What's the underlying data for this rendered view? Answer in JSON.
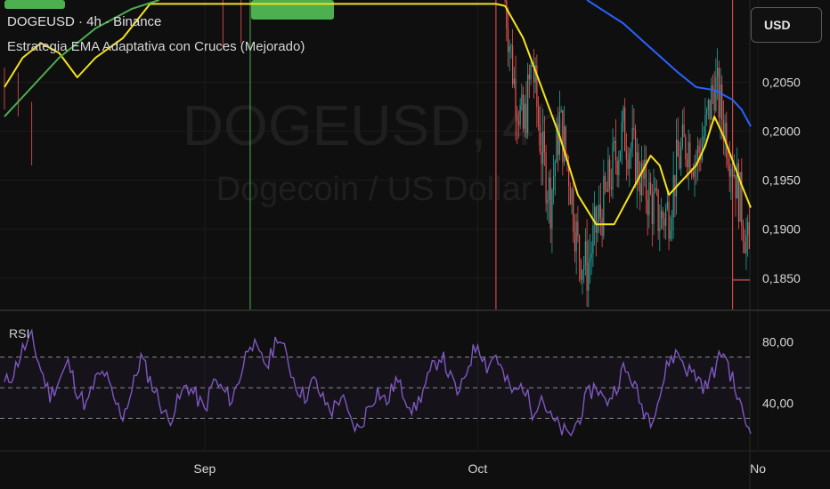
{
  "header": {
    "title": "DOGEUSD · 4h · Binance",
    "indicator": "Estrategia EMA Adaptativa con Cruces (Mejorado)"
  },
  "price_scale": {
    "currency_button": "USD"
  },
  "watermark": {
    "symbol": "DOGEUSD, 4h",
    "description": "Dogecoin / US Dollar"
  },
  "rsi_pane": {
    "label": "RSI"
  },
  "colors": {
    "up": "#26a69a",
    "down": "#ef5350",
    "ema_fast": "#f5e21b",
    "ema_mid": "#4caf50",
    "ema_slow": "#2962ff",
    "rsi": "#7e57c2",
    "signal_green": "#4caf50",
    "signal_red": "#ef5350"
  },
  "chart_data": [
    {
      "type": "candlestick",
      "title": "DOGEUSD · 4h · Binance",
      "x_tick_labels": [
        "Sep",
        "Oct",
        "No"
      ],
      "y_tick_labels": [
        "0,2050",
        "0,2000",
        "0,1950",
        "0,1900",
        "0,1850"
      ],
      "ylim": [
        0.1818,
        0.2134
      ],
      "x_range": [
        "Aug 10",
        "Oct 31"
      ],
      "series": [
        {
          "name": "EMA fast",
          "points": [
            [
              "Aug 10",
              0.2045
            ],
            [
              "Aug 12",
              0.2075
            ],
            [
              "Aug 14",
              0.209
            ],
            [
              "Aug 16",
              0.208
            ],
            [
              "Aug 18",
              0.2055
            ],
            [
              "Aug 20",
              0.2075
            ],
            [
              "Aug 23",
              0.2095
            ],
            [
              "Aug 26",
              0.213
            ],
            [
              "Oct 3",
              0.213
            ],
            [
              "Oct 4",
              0.2128
            ],
            [
              "Oct 6",
              0.2095
            ],
            [
              "Oct 8",
              0.2045
            ],
            [
              "Oct 10",
              0.1995
            ],
            [
              "Oct 12",
              0.1935
            ],
            [
              "Oct 14",
              0.1905
            ],
            [
              "Oct 16",
              0.1905
            ],
            [
              "Oct 18",
              0.194
            ],
            [
              "Oct 20",
              0.1975
            ],
            [
              "Oct 21",
              0.1965
            ],
            [
              "Oct 22",
              0.1935
            ],
            [
              "Oct 23",
              0.1945
            ],
            [
              "Oct 25",
              0.1965
            ],
            [
              "Oct 26",
              0.1985
            ],
            [
              "Oct 27",
              0.2015
            ],
            [
              "Oct 28",
              0.1995
            ],
            [
              "Oct 29",
              0.197
            ],
            [
              "Oct 30",
              0.1945
            ],
            [
              "Oct 31",
              0.1922
            ]
          ]
        },
        {
          "name": "EMA mid",
          "points": [
            [
              "Aug 10",
              0.2015
            ],
            [
              "Aug 13",
              0.2045
            ],
            [
              "Aug 16",
              0.2075
            ],
            [
              "Aug 20",
              0.2105
            ],
            [
              "Aug 24",
              0.2125
            ],
            [
              "Aug 27",
              0.2134
            ]
          ]
        },
        {
          "name": "EMA slow",
          "points": [
            [
              "Oct 13",
              0.2134
            ],
            [
              "Oct 15",
              0.2122
            ],
            [
              "Oct 17",
              0.211
            ],
            [
              "Oct 20",
              0.2085
            ],
            [
              "Oct 23",
              0.206
            ],
            [
              "Oct 25",
              0.2045
            ],
            [
              "Oct 27",
              0.2042
            ],
            [
              "Oct 29",
              0.2032
            ],
            [
              "Oct 30",
              0.2022
            ],
            [
              "Oct 31",
              0.2005
            ]
          ]
        },
        {
          "name": "Price",
          "points": [
            [
              "Oct 4",
              0.2134
            ],
            [
              "Oct 5",
              0.205
            ],
            [
              "Oct 6",
              0.2
            ],
            [
              "Oct 7",
              0.207
            ],
            [
              "Oct 8",
              0.198
            ],
            [
              "Oct 9",
              0.193
            ],
            [
              "Oct 10",
              0.201
            ],
            [
              "Oct 11",
              0.196
            ],
            [
              "Oct 12",
              0.188
            ],
            [
              "Oct 13",
              0.186
            ],
            [
              "Oct 14",
              0.19
            ],
            [
              "Oct 15",
              0.193
            ],
            [
              "Oct 16",
              0.197
            ],
            [
              "Oct 17",
              0.2
            ],
            [
              "Oct 18",
              0.198
            ],
            [
              "Oct 19",
              0.195
            ],
            [
              "Oct 20",
              0.193
            ],
            [
              "Oct 21",
              0.191
            ],
            [
              "Oct 22",
              0.192
            ],
            [
              "Oct 23",
              0.197
            ],
            [
              "Oct 24",
              0.199
            ],
            [
              "Oct 25",
              0.197
            ],
            [
              "Oct 26",
              0.2
            ],
            [
              "Oct 27",
              0.205
            ],
            [
              "Oct 28",
              0.201
            ],
            [
              "Oct 29",
              0.197
            ],
            [
              "Oct 30",
              0.192
            ],
            [
              "Oct 31",
              0.186
            ]
          ]
        }
      ],
      "signals": [
        {
          "date": "Sep 6",
          "color": "green"
        },
        {
          "date": "Oct 3",
          "color": "red"
        },
        {
          "date": "Oct 29",
          "color": "red"
        }
      ],
      "price_line": 0.1848
    },
    {
      "type": "line",
      "title": "RSI",
      "y_tick_labels": [
        "80,00",
        "40,00"
      ],
      "ylim": [
        10,
        100
      ],
      "bands": [
        30,
        50,
        70
      ],
      "series": [
        {
          "name": "RSI",
          "points": [
            [
              "Aug 10",
              52
            ],
            [
              "Aug 11",
              60
            ],
            [
              "Aug 12",
              75
            ],
            [
              "Aug 13",
              82
            ],
            [
              "Aug 14",
              62
            ],
            [
              "Aug 15",
              45
            ],
            [
              "Aug 16",
              55
            ],
            [
              "Aug 17",
              66
            ],
            [
              "Aug 18",
              48
            ],
            [
              "Aug 19",
              38
            ],
            [
              "Aug 20",
              55
            ],
            [
              "Aug 21",
              60
            ],
            [
              "Aug 22",
              42
            ],
            [
              "Aug 23",
              32
            ],
            [
              "Aug 24",
              48
            ],
            [
              "Aug 25",
              70
            ],
            [
              "Aug 26",
              55
            ],
            [
              "Aug 27",
              42
            ],
            [
              "Aug 28",
              28
            ],
            [
              "Aug 29",
              40
            ],
            [
              "Aug 30",
              52
            ],
            [
              "Aug 31",
              45
            ],
            [
              "Sep 1",
              35
            ],
            [
              "Sep 2",
              55
            ],
            [
              "Sep 3",
              48
            ],
            [
              "Sep 4",
              42
            ],
            [
              "Sep 5",
              60
            ],
            [
              "Sep 6",
              82
            ],
            [
              "Sep 7",
              70
            ],
            [
              "Sep 8",
              65
            ],
            [
              "Sep 9",
              85
            ],
            [
              "Sep 10",
              70
            ],
            [
              "Sep 11",
              52
            ],
            [
              "Sep 12",
              44
            ],
            [
              "Sep 13",
              55
            ],
            [
              "Sep 14",
              42
            ],
            [
              "Sep 15",
              35
            ],
            [
              "Sep 16",
              45
            ],
            [
              "Sep 17",
              28
            ],
            [
              "Sep 18",
              22
            ],
            [
              "Sep 19",
              38
            ],
            [
              "Sep 20",
              48
            ],
            [
              "Sep 21",
              40
            ],
            [
              "Sep 22",
              55
            ],
            [
              "Sep 23",
              45
            ],
            [
              "Sep 24",
              35
            ],
            [
              "Sep 25",
              48
            ],
            [
              "Sep 26",
              62
            ],
            [
              "Sep 27",
              72
            ],
            [
              "Sep 28",
              56
            ],
            [
              "Sep 29",
              45
            ],
            [
              "Sep 30",
              66
            ],
            [
              "Oct 1",
              80
            ],
            [
              "Oct 2",
              64
            ],
            [
              "Oct 3",
              72
            ],
            [
              "Oct 4",
              55
            ],
            [
              "Oct 5",
              46
            ],
            [
              "Oct 6",
              52
            ],
            [
              "Oct 7",
              35
            ],
            [
              "Oct 8",
              45
            ],
            [
              "Oct 9",
              30
            ],
            [
              "Oct 10",
              24
            ],
            [
              "Oct 11",
              18
            ],
            [
              "Oct 12",
              28
            ],
            [
              "Oct 13",
              44
            ],
            [
              "Oct 14",
              52
            ],
            [
              "Oct 15",
              40
            ],
            [
              "Oct 16",
              48
            ],
            [
              "Oct 17",
              62
            ],
            [
              "Oct 18",
              55
            ],
            [
              "Oct 19",
              38
            ],
            [
              "Oct 20",
              30
            ],
            [
              "Oct 21",
              45
            ],
            [
              "Oct 22",
              68
            ],
            [
              "Oct 23",
              73
            ],
            [
              "Oct 24",
              62
            ],
            [
              "Oct 25",
              58
            ],
            [
              "Oct 26",
              50
            ],
            [
              "Oct 27",
              62
            ],
            [
              "Oct 28",
              75
            ],
            [
              "Oct 29",
              55
            ],
            [
              "Oct 30",
              35
            ],
            [
              "Oct 31",
              20
            ]
          ]
        }
      ]
    }
  ]
}
